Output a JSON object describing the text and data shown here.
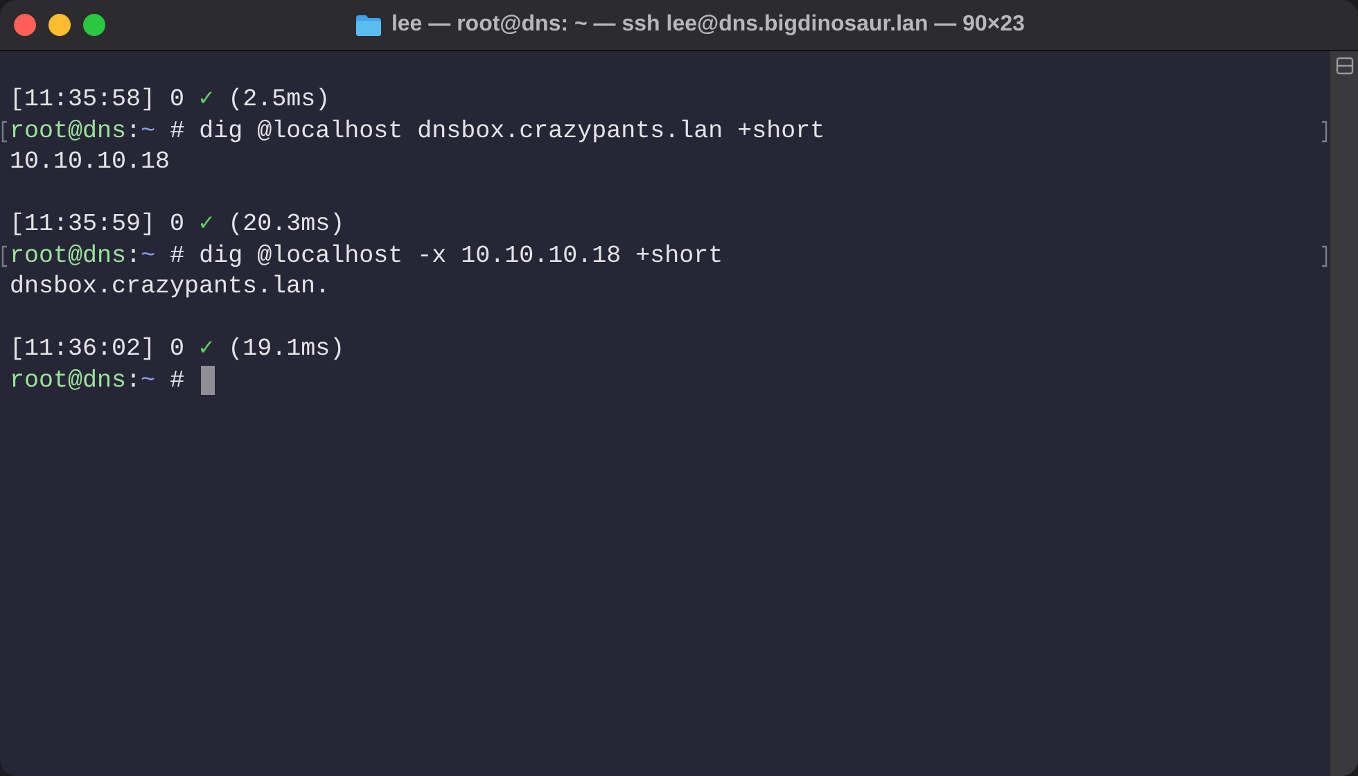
{
  "window": {
    "title": "lee — root@dns: ~ — ssh lee@dns.bigdinosaur.lan — 90×23"
  },
  "lines": [
    {
      "kind": "status",
      "time": "[11:35:58]",
      "code": "0",
      "check": "✓",
      "duration": "(2.5ms)"
    },
    {
      "kind": "prompt",
      "user": "root@dns",
      "sep": ":",
      "dir": "~",
      "symbol": "#",
      "command": "dig @localhost dnsbox.crazypants.lan +short",
      "marked": true,
      "cursor": false
    },
    {
      "kind": "output",
      "text": "10.10.10.18"
    },
    {
      "kind": "blank"
    },
    {
      "kind": "status",
      "time": "[11:35:59]",
      "code": "0",
      "check": "✓",
      "duration": "(20.3ms)"
    },
    {
      "kind": "prompt",
      "user": "root@dns",
      "sep": ":",
      "dir": "~",
      "symbol": "#",
      "command": "dig @localhost -x 10.10.10.18 +short",
      "marked": true,
      "cursor": false
    },
    {
      "kind": "output",
      "text": "dnsbox.crazypants.lan."
    },
    {
      "kind": "blank"
    },
    {
      "kind": "status",
      "time": "[11:36:02]",
      "code": "0",
      "check": "✓",
      "duration": "(19.1ms)"
    },
    {
      "kind": "prompt",
      "user": "root@dns",
      "sep": ":",
      "dir": "~",
      "symbol": "#",
      "marked": false,
      "cursor": true
    }
  ]
}
